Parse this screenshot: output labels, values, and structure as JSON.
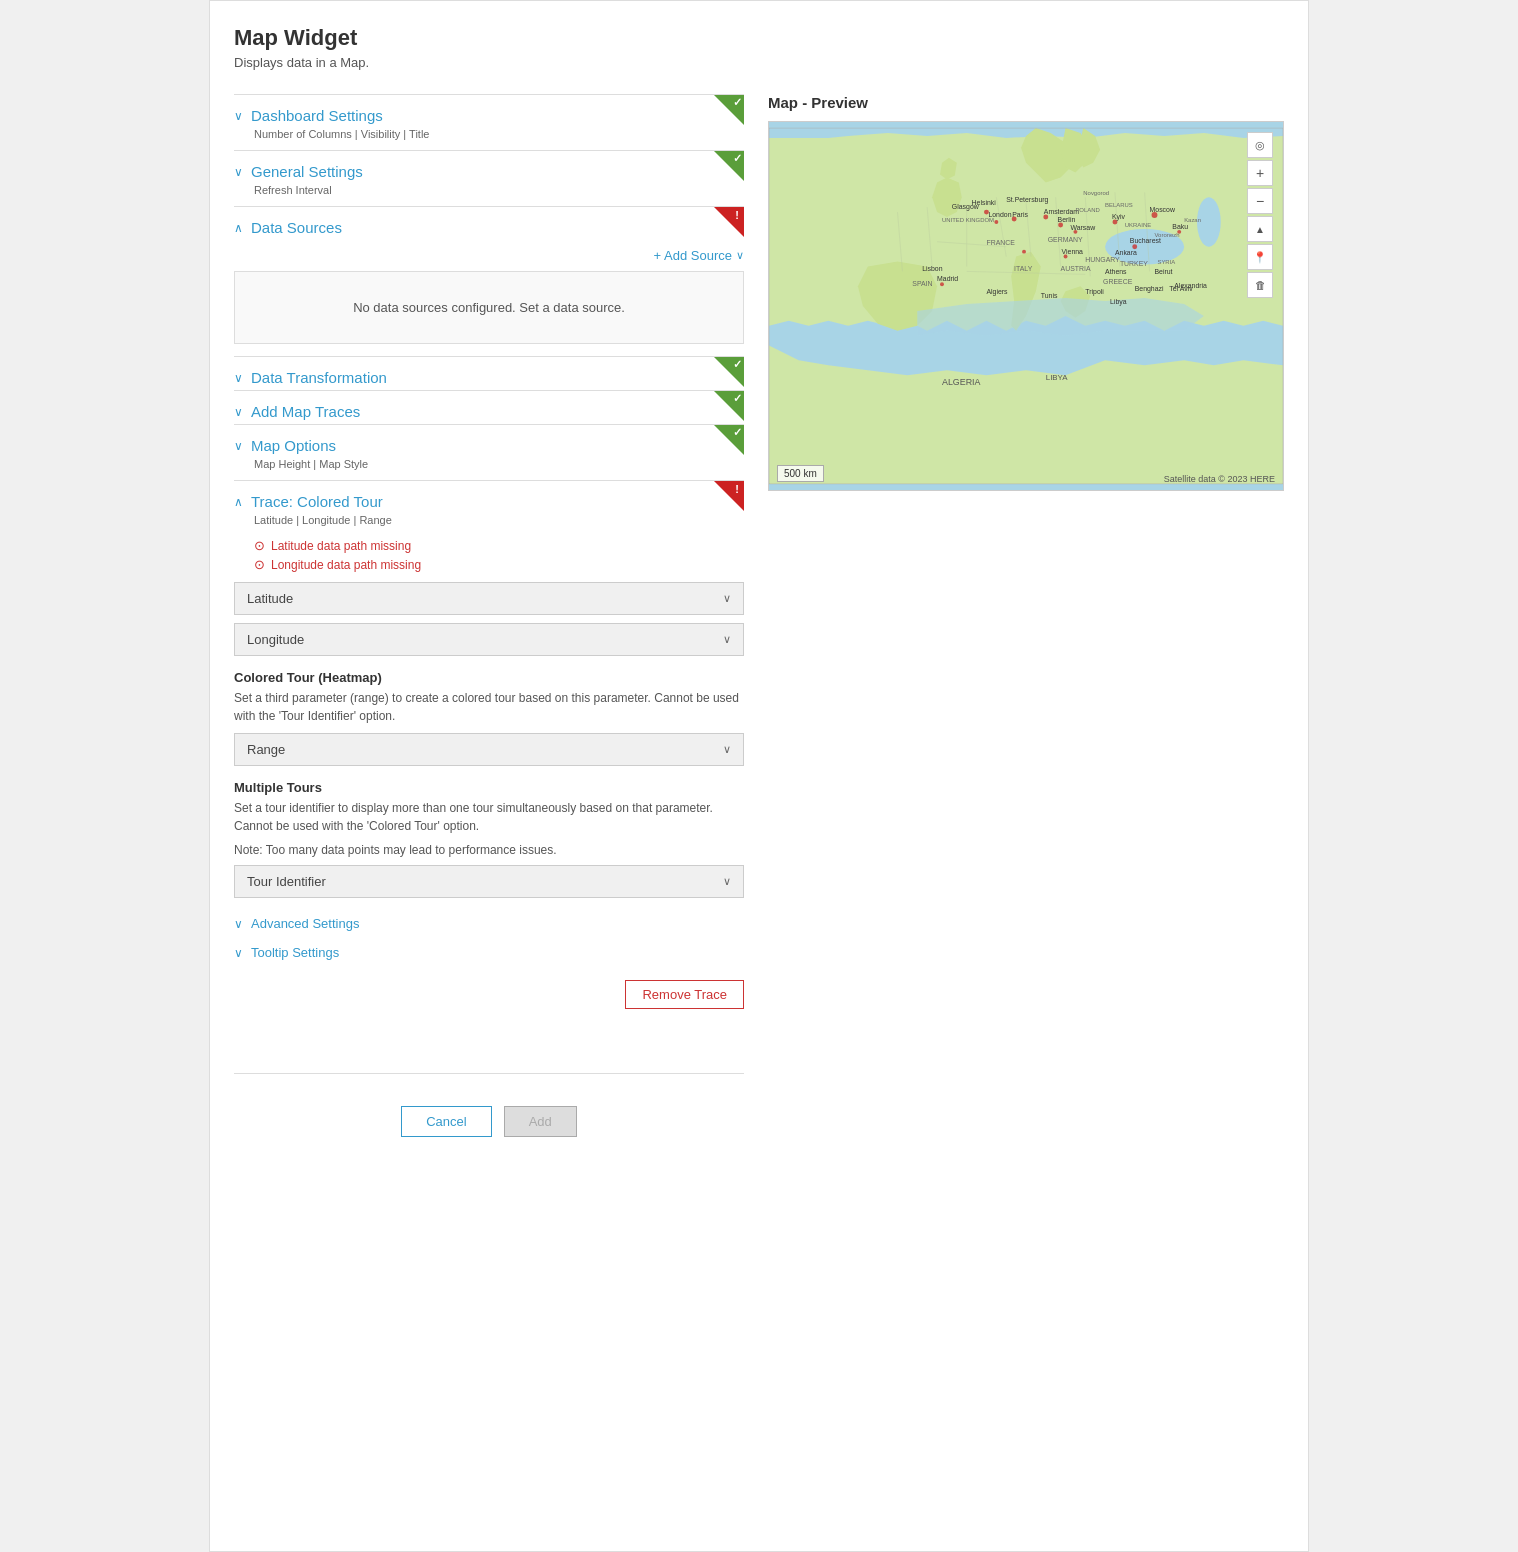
{
  "page": {
    "title": "Map Widget",
    "subtitle": "Displays data in a Map."
  },
  "sections": {
    "dashboard_settings": {
      "label": "Dashboard Settings",
      "subtitle": "Number of Columns | Visibility | Title",
      "badge": "green"
    },
    "general_settings": {
      "label": "General Settings",
      "subtitle": "Refresh Interval",
      "badge": "green"
    },
    "data_sources": {
      "label": "Data Sources",
      "badge": "red",
      "add_source_label": "+ Add Source",
      "no_sources_msg": "No data sources configured. Set a data source."
    },
    "data_transformation": {
      "label": "Data Transformation",
      "badge": "green"
    },
    "add_map_traces": {
      "label": "Add Map Traces",
      "badge": "green"
    },
    "map_options": {
      "label": "Map Options",
      "subtitle": "Map Height | Map Style",
      "badge": "green"
    },
    "trace_colored_tour": {
      "label": "Trace: Colored Tour",
      "subtitle": "Latitude | Longitude | Range",
      "badge": "red",
      "errors": [
        "Latitude data path missing",
        "Longitude data path missing"
      ],
      "latitude_dropdown": "Latitude",
      "longitude_dropdown": "Longitude",
      "colored_tour_title": "Colored Tour (Heatmap)",
      "colored_tour_desc": "Set a third parameter (range) to create a colored tour based on this parameter. Cannot be used with the 'Tour Identifier' option.",
      "range_dropdown": "Range",
      "multiple_tours_title": "Multiple Tours",
      "multiple_tours_desc": "Set a tour identifier to display more than one tour simultaneously based on that parameter. Cannot be used with the 'Colored Tour' option.",
      "multiple_tours_note": "Note: Too many data points may lead to performance issues.",
      "tour_identifier_dropdown": "Tour Identifier",
      "advanced_settings_label": "Advanced Settings",
      "tooltip_settings_label": "Tooltip Settings",
      "remove_trace_label": "Remove Trace"
    }
  },
  "map_preview": {
    "title": "Map - Preview",
    "scale_label": "500 km",
    "attribution": "Satellite data © 2023 HERE"
  },
  "buttons": {
    "cancel": "Cancel",
    "add": "Add"
  },
  "icons": {
    "chevron_down": "∨",
    "chevron_up": "∧",
    "plus": "+",
    "check": "✓",
    "exclamation": "!",
    "zoom_in": "+",
    "zoom_out": "−",
    "location": "◎",
    "trash": "🗑",
    "arrow": "▲"
  }
}
